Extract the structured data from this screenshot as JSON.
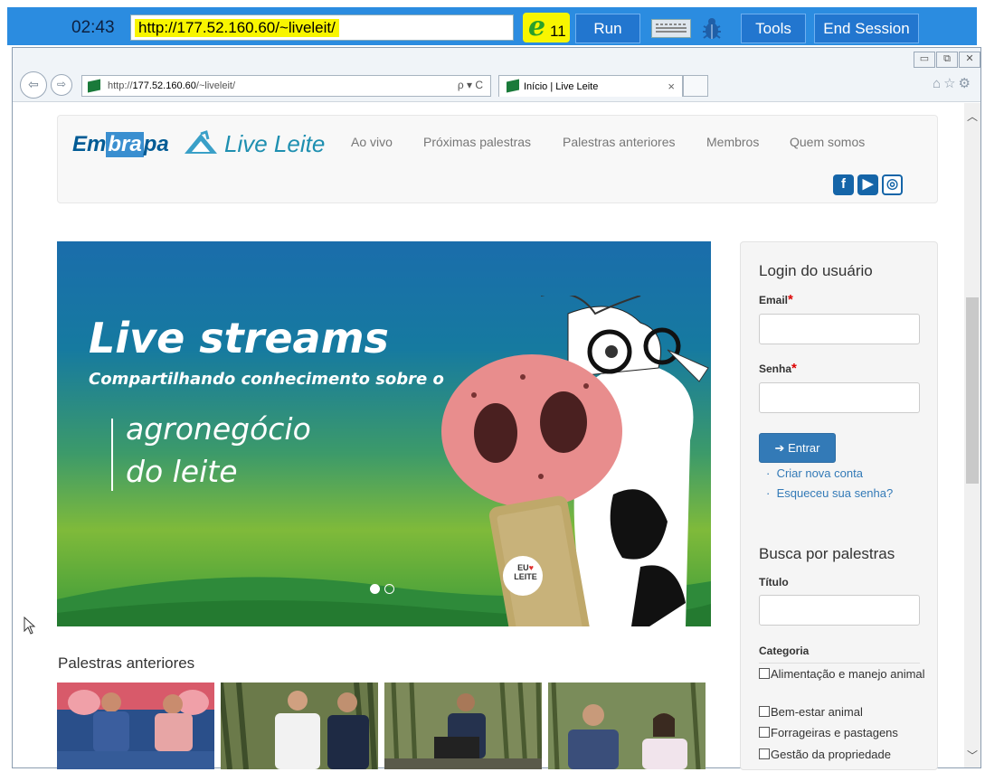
{
  "session": {
    "timer": "02:43",
    "url": "http://177.52.160.60/~liveleit/",
    "browser_version": "11",
    "run_label": "Run",
    "tools_label": "Tools",
    "end_session_label": "End Session"
  },
  "browser": {
    "address_prefix": "http://",
    "address_host": "177.52.160.60",
    "address_path": "/~liveleit/",
    "search_controls": "ρ ▾ C",
    "tab_title": "Início | Live Leite",
    "tab_close": "×"
  },
  "site": {
    "logo_embrapa_a": "Em",
    "logo_embrapa_b": "bra",
    "logo_embrapa_c": "pa",
    "logo_live": "Live Leite",
    "menu": [
      "Ao vivo",
      "Próximas palestras",
      "Palestras anteriores",
      "Membros",
      "Quem somos"
    ],
    "social": [
      "facebook-icon",
      "youtube-icon",
      "instagram-icon"
    ]
  },
  "banner": {
    "title": "Live streams",
    "subtitle": "Compartilhando conhecimento sobre o",
    "line1": "agronegócio",
    "line2": "do leite",
    "badge_line1": "EU",
    "badge_line2": "LEITE",
    "slide_count": 2,
    "active_slide": 1
  },
  "login": {
    "heading": "Login do usuário",
    "email_label": "Email",
    "password_label": "Senha",
    "required_mark": "*",
    "submit_label": "Entrar",
    "link_create": "Criar nova conta",
    "link_forgot": "Esqueceu sua senha?"
  },
  "search": {
    "heading": "Busca por palestras",
    "title_label": "Título",
    "category_label": "Categoria",
    "categories": [
      "Alimentação e manejo animal",
      "Bem-estar animal",
      "Forrageiras e pastagens",
      "Gestão da propriedade"
    ]
  },
  "previous": {
    "heading": "Palestras anteriores"
  }
}
